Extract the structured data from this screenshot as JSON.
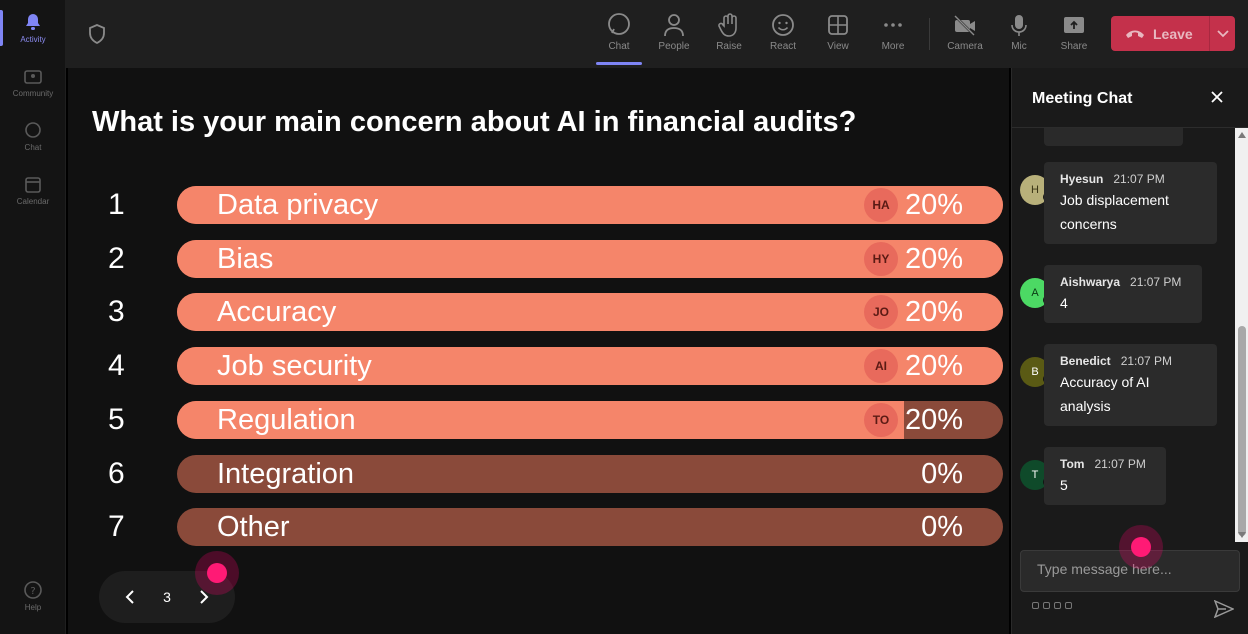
{
  "rail": {
    "items": [
      {
        "label": "Activity",
        "icon": "bell-icon"
      },
      {
        "label": "Community",
        "icon": "community-icon"
      },
      {
        "label": "Chat",
        "icon": "chat-icon"
      },
      {
        "label": "Calendar",
        "icon": "calendar-icon"
      }
    ],
    "help": {
      "label": "Help",
      "icon": "help-icon"
    }
  },
  "toolbar": {
    "tools": [
      {
        "label": "Chat",
        "icon": "chat-icon"
      },
      {
        "label": "People",
        "icon": "people-icon"
      },
      {
        "label": "Raise",
        "icon": "hand-icon"
      },
      {
        "label": "React",
        "icon": "smile-icon"
      },
      {
        "label": "View",
        "icon": "grid-icon"
      },
      {
        "label": "More",
        "icon": "more-icon"
      },
      {
        "label": "Camera",
        "icon": "camera-off-icon"
      },
      {
        "label": "Mic",
        "icon": "mic-icon"
      },
      {
        "label": "Share",
        "icon": "share-icon"
      }
    ],
    "leave_label": "Leave"
  },
  "poll": {
    "question": "What is your main concern about AI in financial audits?",
    "options": [
      {
        "num": "1",
        "label": "Data privacy",
        "pct": "20%",
        "avatar": "HA",
        "fill": 1.0
      },
      {
        "num": "2",
        "label": "Bias",
        "pct": "20%",
        "avatar": "HY",
        "fill": 1.0
      },
      {
        "num": "3",
        "label": "Accuracy",
        "pct": "20%",
        "avatar": "JO",
        "fill": 1.0
      },
      {
        "num": "4",
        "label": "Job security",
        "pct": "20%",
        "avatar": "AI",
        "fill": 1.0
      },
      {
        "num": "5",
        "label": "Regulation",
        "pct": "20%",
        "avatar": "TO",
        "fill": 0.88
      },
      {
        "num": "6",
        "label": "Integration",
        "pct": "0%",
        "avatar": "",
        "fill": 0
      },
      {
        "num": "7",
        "label": "Other",
        "pct": "0%",
        "avatar": "",
        "fill": 0
      }
    ],
    "page": "3"
  },
  "chat": {
    "title": "Meeting Chat",
    "messages": [
      {
        "name": "Hyesun",
        "time": "21:07 PM",
        "initial": "H",
        "text": "Job displacement concerns",
        "avatar_color": "#b8b07a"
      },
      {
        "name": "Aishwarya",
        "time": "21:07 PM",
        "initial": "A",
        "text": "4",
        "avatar_color": "#4cd964"
      },
      {
        "name": "Benedict",
        "time": "21:07 PM",
        "initial": "B",
        "text": "Accuracy of AI analysis",
        "avatar_color": "#5a5a14"
      },
      {
        "name": "Tom",
        "time": "21:07 PM",
        "initial": "T",
        "text": "5",
        "avatar_color": "#0f4a2a"
      }
    ],
    "composer_placeholder": "Type message here..."
  }
}
